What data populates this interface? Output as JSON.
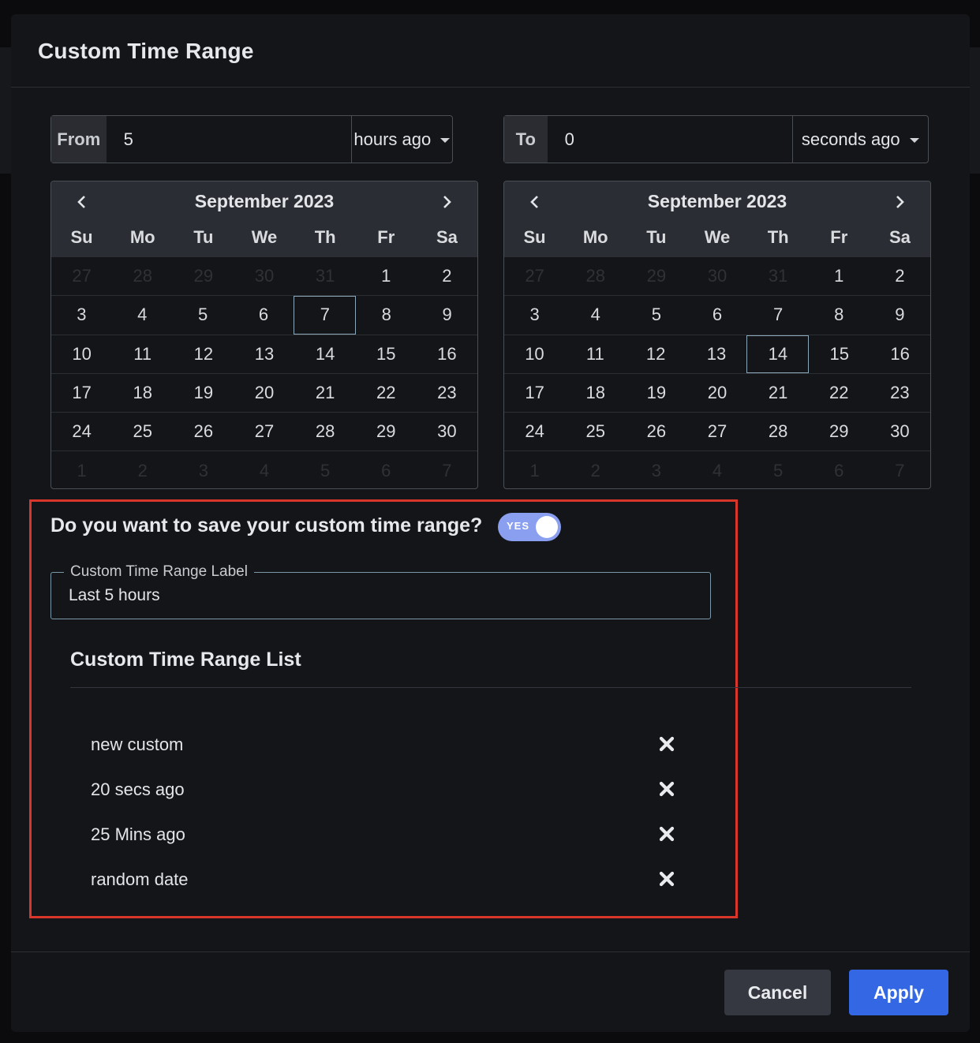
{
  "dialog": {
    "title": "Custom Time Range"
  },
  "from": {
    "label": "From",
    "value": "5",
    "unit": "hours ago"
  },
  "to": {
    "label": "To",
    "value": "0",
    "unit": "seconds ago"
  },
  "calendars": [
    {
      "month_label": "September 2023",
      "weekdays": [
        "Su",
        "Mo",
        "Tu",
        "We",
        "Th",
        "Fr",
        "Sa"
      ],
      "selected_day": "7",
      "weeks": [
        [
          "27",
          "28",
          "29",
          "30",
          "31",
          "1",
          "2"
        ],
        [
          "3",
          "4",
          "5",
          "6",
          "7",
          "8",
          "9"
        ],
        [
          "10",
          "11",
          "12",
          "13",
          "14",
          "15",
          "16"
        ],
        [
          "17",
          "18",
          "19",
          "20",
          "21",
          "22",
          "23"
        ],
        [
          "24",
          "25",
          "26",
          "27",
          "28",
          "29",
          "30"
        ],
        [
          "1",
          "2",
          "3",
          "4",
          "5",
          "6",
          "7"
        ]
      ]
    },
    {
      "month_label": "September 2023",
      "weekdays": [
        "Su",
        "Mo",
        "Tu",
        "We",
        "Th",
        "Fr",
        "Sa"
      ],
      "selected_day": "14",
      "weeks": [
        [
          "27",
          "28",
          "29",
          "30",
          "31",
          "1",
          "2"
        ],
        [
          "3",
          "4",
          "5",
          "6",
          "7",
          "8",
          "9"
        ],
        [
          "10",
          "11",
          "12",
          "13",
          "14",
          "15",
          "16"
        ],
        [
          "17",
          "18",
          "19",
          "20",
          "21",
          "22",
          "23"
        ],
        [
          "24",
          "25",
          "26",
          "27",
          "28",
          "29",
          "30"
        ],
        [
          "1",
          "2",
          "3",
          "4",
          "5",
          "6",
          "7"
        ]
      ]
    }
  ],
  "save": {
    "question": "Do you want to save your custom time range?",
    "toggle_label": "YES",
    "toggle_on": true,
    "label_field": {
      "legend": "Custom Time Range Label",
      "value": "Last 5 hours"
    }
  },
  "saved_list": {
    "title": "Custom Time Range List",
    "items": [
      {
        "label": "new custom"
      },
      {
        "label": "20 secs ago"
      },
      {
        "label": "25 Mins ago"
      },
      {
        "label": "random date"
      }
    ]
  },
  "footer": {
    "cancel_label": "Cancel",
    "apply_label": "Apply"
  },
  "colors": {
    "modal_bg": "#141518",
    "highlight_border": "#d9362b",
    "apply_button": "#3367e3",
    "toggle_on": "#8a9ff0"
  }
}
